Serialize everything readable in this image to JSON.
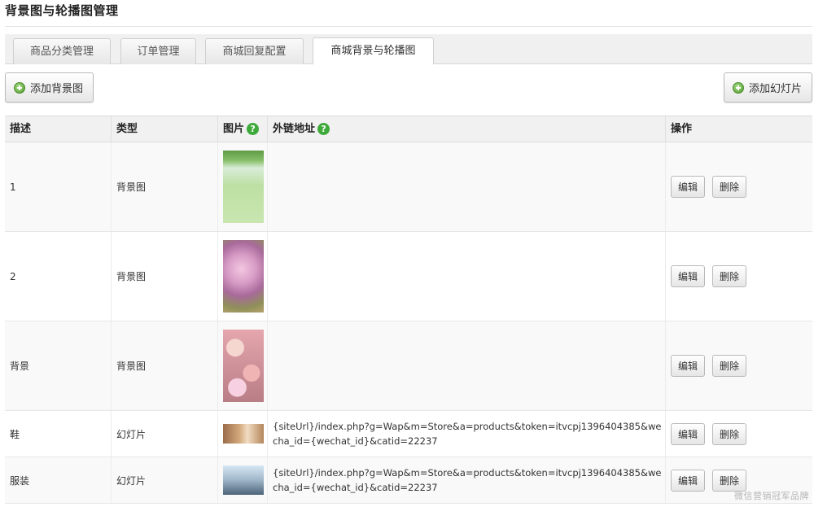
{
  "page": {
    "title": "背景图与轮播图管理"
  },
  "tabs": [
    {
      "label": "商品分类管理"
    },
    {
      "label": "订单管理"
    },
    {
      "label": "商城回复配置"
    },
    {
      "label": "商城背景与轮播图"
    }
  ],
  "toolbar": {
    "add_background_label": "添加背景图",
    "add_slide_label": "添加幻灯片"
  },
  "table": {
    "headers": {
      "description": "描述",
      "type": "类型",
      "image": "图片",
      "link": "外链地址",
      "actions": "操作"
    },
    "help_glyph": "?",
    "rows": [
      {
        "description": "1",
        "type": "背景图",
        "link": "",
        "thumb": "green-bottle"
      },
      {
        "description": "2",
        "type": "背景图",
        "link": "",
        "thumb": "pink-flower"
      },
      {
        "description": "背景",
        "type": "背景图",
        "link": "",
        "thumb": "flower-pattern"
      },
      {
        "description": "鞋",
        "type": "幻灯片",
        "link": "{siteUrl}/index.php?g=Wap&m=Store&a=products&token=itvcpj1396404385&wecha_id={wechat_id}&catid=22237",
        "thumb": "shoes"
      },
      {
        "description": "服装",
        "type": "幻灯片",
        "link": "{siteUrl}/index.php?g=Wap&m=Store&a=products&token=itvcpj1396404385&wecha_id={wechat_id}&catid=22237",
        "thumb": "couple-photo"
      }
    ],
    "edit_label": "编辑",
    "delete_label": "删除"
  },
  "watermark": "微信营销冠军品牌",
  "icons": [
    "plus-circle-icon",
    "help-icon"
  ],
  "colors": {
    "help_green": "#3eaa3a",
    "header_bg": "#f1f1f1"
  }
}
